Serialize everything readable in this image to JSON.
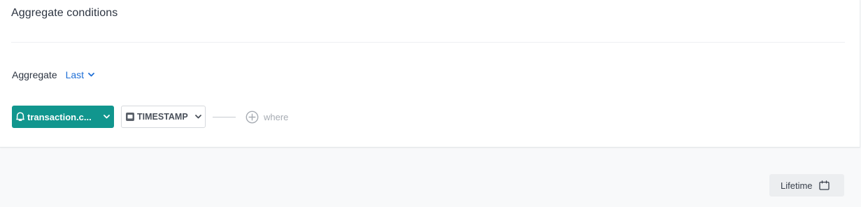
{
  "section": {
    "title": "Aggregate conditions"
  },
  "aggregate": {
    "label": "Aggregate",
    "selected": "Last"
  },
  "condition": {
    "event_name": "transaction.c...",
    "attribute": "TIMESTAMP",
    "where_label": "where"
  },
  "footer": {
    "lifetime_label": "Lifetime"
  },
  "colors": {
    "event_chip": "#11968e",
    "link_blue": "#1f6fd6"
  },
  "icons": {
    "event": "event-bell-icon",
    "attribute": "calendar-box-icon",
    "chevron": "chevron-down-icon",
    "add": "add-circle-icon",
    "calendar": "calendar-icon"
  }
}
